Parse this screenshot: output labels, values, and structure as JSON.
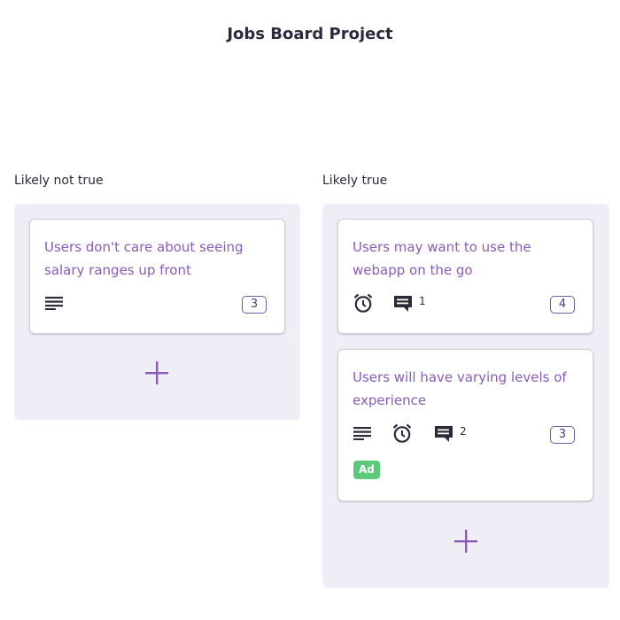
{
  "board": {
    "title": "Jobs Board Project"
  },
  "columns": [
    {
      "header": "Likely not true",
      "cards": [
        {
          "title": "Users don't care about seeing salary ranges up front",
          "points": "3",
          "icons": [
            "description-icon"
          ]
        }
      ]
    },
    {
      "header": "Likely true",
      "cards": [
        {
          "title": "Users may want to use the webapp on the go",
          "points": "4",
          "icons": [
            "alarm-icon",
            "comment-icon"
          ],
          "comments": "1"
        },
        {
          "title": "Users will have varying levels of experience",
          "points": "3",
          "icons": [
            "description-icon",
            "alarm-icon",
            "comment-icon"
          ],
          "comments": "2",
          "label": "Ad"
        }
      ]
    }
  ],
  "colors": {
    "title_text": "#8a5cb8",
    "column_bg": "#efeef6",
    "label_green": "#5cc97d",
    "add_icon": "#8a5cb8"
  }
}
